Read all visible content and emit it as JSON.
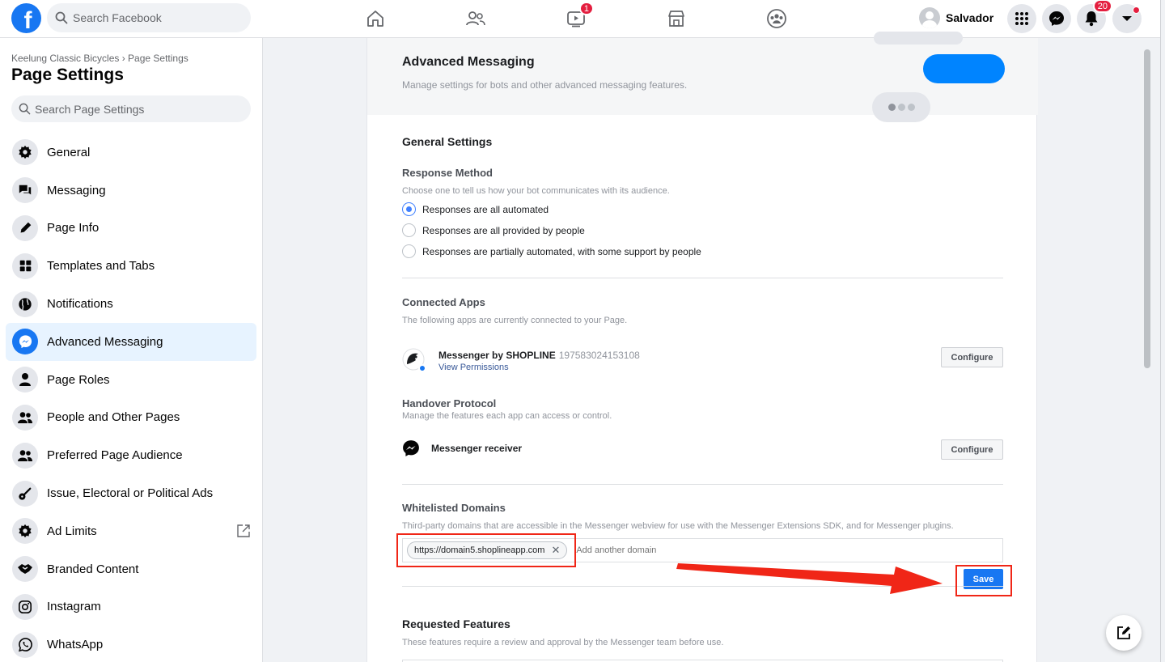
{
  "topbar": {
    "logo": "f",
    "search_placeholder": "Search Facebook",
    "watch_badge": "1",
    "profile_name": "Salvador",
    "notifications_badge": "20"
  },
  "sidebar": {
    "breadcrumb": "Keelung Classic Bicycles › Page Settings",
    "title": "Page Settings",
    "search_placeholder": "Search Page Settings",
    "items": [
      {
        "label": "General",
        "icon": "gear-icon"
      },
      {
        "label": "Messaging",
        "icon": "chat-icon"
      },
      {
        "label": "Page Info",
        "icon": "pencil-icon"
      },
      {
        "label": "Templates and Tabs",
        "icon": "grid-icon"
      },
      {
        "label": "Notifications",
        "icon": "globe-icon"
      },
      {
        "label": "Advanced Messaging",
        "icon": "messenger-icon"
      },
      {
        "label": "Page Roles",
        "icon": "person-icon"
      },
      {
        "label": "People and Other Pages",
        "icon": "people-icon"
      },
      {
        "label": "Preferred Page Audience",
        "icon": "people-icon"
      },
      {
        "label": "Issue, Electoral or Political Ads",
        "icon": "guitar-icon"
      },
      {
        "label": "Ad Limits",
        "icon": "gear-icon"
      },
      {
        "label": "Branded Content",
        "icon": "handshake-icon"
      },
      {
        "label": "Instagram",
        "icon": "instagram-icon"
      },
      {
        "label": "WhatsApp",
        "icon": "whatsapp-icon"
      }
    ]
  },
  "main": {
    "header_title": "Advanced Messaging",
    "header_subtitle": "Manage settings for bots and other advanced messaging features.",
    "general_title": "General Settings",
    "response_method": {
      "title": "Response Method",
      "desc": "Choose one to tell us how your bot communicates with its audience.",
      "options": [
        {
          "label": "Responses are all automated",
          "checked": true
        },
        {
          "label": "Responses are all provided by people",
          "checked": false
        },
        {
          "label": "Responses are partially automated, with some support by people",
          "checked": false
        }
      ]
    },
    "connected_apps": {
      "title": "Connected Apps",
      "desc": "The following apps are currently connected to your Page.",
      "app_name": "Messenger by SHOPLINE",
      "app_id": "197583024153108",
      "app_link": "View Permissions",
      "configure": "Configure"
    },
    "handover": {
      "title": "Handover Protocol",
      "desc": "Manage the features each app can access or control.",
      "app_name": "Messenger receiver",
      "configure": "Configure"
    },
    "whitelisted": {
      "title": "Whitelisted Domains",
      "desc": "Third-party domains that are accessible in the Messenger webview for use with the Messenger Extensions SDK, and for Messenger plugins.",
      "domain": "https://domain5.shoplineapp.com",
      "remove": "✕",
      "placeholder": "Add another domain",
      "save": "Save"
    },
    "requested": {
      "title": "Requested Features",
      "desc": "These features require a review and approval by the Messenger team before use."
    }
  },
  "colors": {
    "brand": "#1877f2",
    "annotation": "#f02617",
    "badge": "#e41e3f"
  }
}
